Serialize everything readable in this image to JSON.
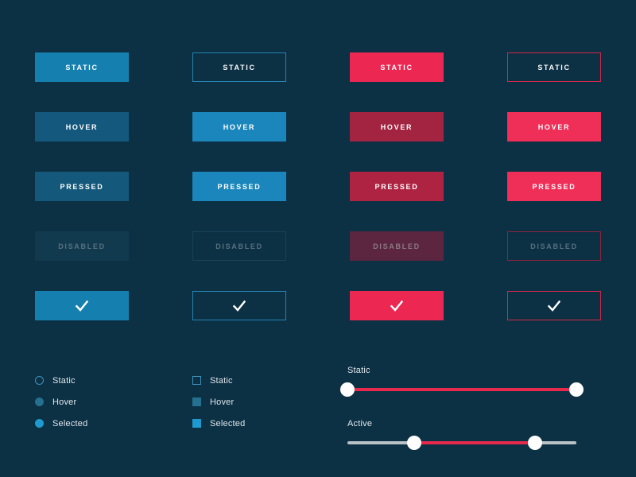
{
  "theme": {
    "background": "#0c3044",
    "blue_static": "#1580b0",
    "blue_hover": "#14597d",
    "blue_pressed": "#14597b",
    "blue_bright": "#1b86bb",
    "blue_disabled": "#123a4f",
    "red_static": "#ec2752",
    "red_hover": "#a32440",
    "red_pressed": "#ae2342",
    "red_bright": "#ef2f58",
    "red_disabled": "#5c2640",
    "text_light": "#ffffff",
    "text_muted": "#587080",
    "slider_track": "#b9c2c6",
    "slider_fill": "#e8294e",
    "handle": "#ffffff"
  },
  "buttons": {
    "rows": [
      {
        "key": "static",
        "label": "STATIC"
      },
      {
        "key": "hover",
        "label": "HOVER"
      },
      {
        "key": "pressed",
        "label": "PRESSED"
      },
      {
        "key": "disabled",
        "label": "DISABLED"
      },
      {
        "key": "confirm",
        "label": "",
        "icon": "check-icon"
      }
    ],
    "columns": [
      {
        "key": "solid-blue",
        "style": "filled",
        "accent": "#1580b0"
      },
      {
        "key": "outline-blue",
        "style": "outlined",
        "accent": "#2585b5"
      },
      {
        "key": "solid-red",
        "style": "filled",
        "accent": "#ec2752"
      },
      {
        "key": "outline-red",
        "style": "outlined",
        "accent": "#d42748"
      }
    ],
    "matrix": [
      [
        "STATIC",
        "STATIC",
        "STATIC",
        "STATIC"
      ],
      [
        "HOVER",
        "HOVER",
        "HOVER",
        "HOVER"
      ],
      [
        "PRESSED",
        "PRESSED",
        "PRESSED",
        "PRESSED"
      ],
      [
        "DISABLED",
        "DISABLED",
        "DISABLED",
        "DISABLED"
      ],
      [
        "",
        "",
        "",
        ""
      ]
    ]
  },
  "radios": {
    "items": [
      {
        "state": "static",
        "label": "Static"
      },
      {
        "state": "hover",
        "label": "Hover"
      },
      {
        "state": "selected",
        "label": "Selected"
      }
    ]
  },
  "checkboxes": {
    "items": [
      {
        "state": "static",
        "label": "Static"
      },
      {
        "state": "hover",
        "label": "Hover"
      },
      {
        "state": "selected",
        "label": "Selected"
      }
    ]
  },
  "sliders": [
    {
      "key": "static",
      "label": "Static",
      "type": "range",
      "fill_start_pct": 0,
      "fill_end_pct": 100,
      "handles": [
        0,
        100
      ]
    },
    {
      "key": "active",
      "label": "Active",
      "type": "range",
      "fill_start_pct": 29,
      "fill_end_pct": 82,
      "handles": [
        29,
        82
      ]
    }
  ]
}
